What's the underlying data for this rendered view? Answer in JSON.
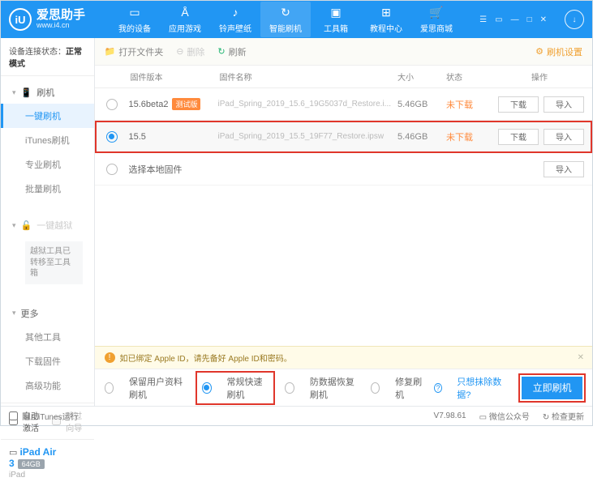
{
  "titlebar": {
    "logo_letter": "iU",
    "brand": "爱思助手",
    "site": "www.i4.cn",
    "nav": [
      {
        "label": "我的设备"
      },
      {
        "label": "应用游戏"
      },
      {
        "label": "铃声壁纸"
      },
      {
        "label": "智能刷机"
      },
      {
        "label": "工具箱"
      },
      {
        "label": "教程中心"
      },
      {
        "label": "爱思商城"
      }
    ]
  },
  "sidebar": {
    "conn_label": "设备连接状态：",
    "conn_value": "正常模式",
    "sections": {
      "flash_head": "刷机",
      "flash_items": [
        "一键刷机",
        "iTunes刷机",
        "专业刷机",
        "批量刷机"
      ],
      "jail_head": "一键越狱",
      "jail_note": "越狱工具已转移至工具箱",
      "more_head": "更多",
      "more_items": [
        "其他工具",
        "下载固件",
        "高级功能"
      ]
    },
    "auto_act": "自动激活",
    "skip_guide": "跳过向导",
    "device": {
      "name": "iPad Air 3",
      "storage": "64GB",
      "model": "iPad"
    }
  },
  "toolbar": {
    "open": "打开文件夹",
    "delete": "删除",
    "refresh": "刷新",
    "settings": "刷机设置"
  },
  "list": {
    "head": {
      "version": "固件版本",
      "name": "固件名称",
      "size": "大小",
      "status": "状态",
      "op": "操作"
    },
    "rows": [
      {
        "version": "15.6beta2",
        "beta": "测试版",
        "name": "iPad_Spring_2019_15.6_19G5037d_Restore.i...",
        "size": "5.46GB",
        "status": "未下载",
        "selected": false,
        "download": "下载",
        "import": "导入"
      },
      {
        "version": "15.5",
        "beta": "",
        "name": "iPad_Spring_2019_15.5_19F77_Restore.ipsw",
        "size": "5.46GB",
        "status": "未下载",
        "selected": true,
        "download": "下载",
        "import": "导入"
      }
    ],
    "local_label": "选择本地固件",
    "local_import": "导入"
  },
  "warn": {
    "text": "如已绑定 Apple ID，请先备好 Apple ID和密码。"
  },
  "mode": {
    "opts": [
      "保留用户资料刷机",
      "常规快速刷机",
      "防数据恢复刷机",
      "修复刷机"
    ],
    "link": "只想抹除数据?",
    "flash_btn": "立即刷机"
  },
  "status": {
    "block_itunes": "阻止iTunes运行",
    "version": "V7.98.61",
    "wechat": "微信公众号",
    "update": "检查更新"
  }
}
